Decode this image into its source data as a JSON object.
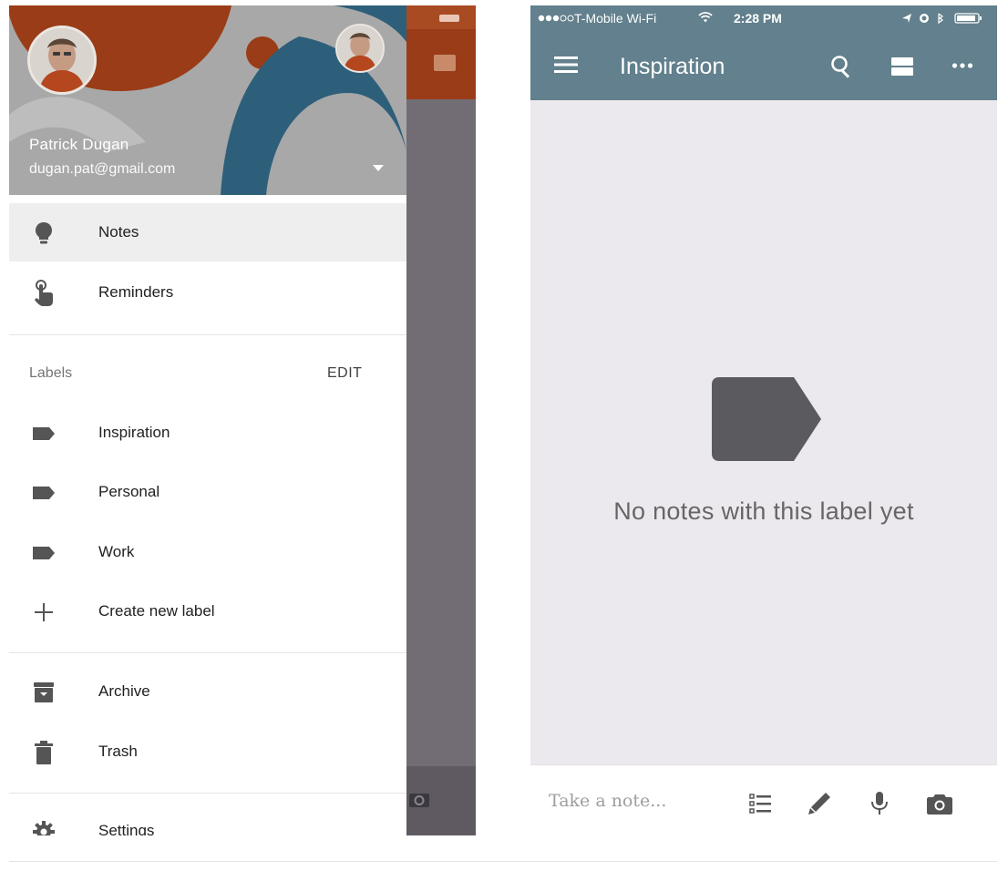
{
  "drawer": {
    "user": {
      "name": "Patrick Dugan",
      "email": "dugan.pat@gmail.com"
    },
    "items": [
      {
        "label": "Notes",
        "icon": "lightbulb-icon",
        "active": true
      },
      {
        "label": "Reminders",
        "icon": "reminder-hand-icon"
      }
    ],
    "labels_section": {
      "title": "Labels",
      "edit_label": "EDIT",
      "labels": [
        {
          "label": "Inspiration",
          "icon": "label-tag-icon"
        },
        {
          "label": "Personal",
          "icon": "label-tag-icon"
        },
        {
          "label": "Work",
          "icon": "label-tag-icon"
        }
      ],
      "create_label": "Create new label"
    },
    "bottom_items": [
      {
        "label": "Archive",
        "icon": "archive-icon"
      },
      {
        "label": "Trash",
        "icon": "trash-icon"
      },
      {
        "label": "Settings",
        "icon": "gear-icon"
      }
    ]
  },
  "right_phone": {
    "status_bar": {
      "carrier": "T-Mobile Wi-Fi",
      "time": "2:28 PM"
    },
    "app_bar": {
      "title": "Inspiration",
      "icons": [
        "menu-icon",
        "search-icon",
        "view-toggle-icon",
        "more-icon"
      ]
    },
    "empty_state": {
      "message": "No notes with this label yet"
    },
    "bottom_bar": {
      "placeholder": "Take a note...",
      "icons": [
        "list-icon",
        "pen-icon",
        "mic-icon",
        "camera-icon"
      ]
    }
  },
  "colors": {
    "app_bar": "#62808d",
    "header_orange": "#9a3c17",
    "header_teal": "#2e5f7a",
    "header_gray": "#a8a8a8",
    "empty_bg": "#ece9ee"
  }
}
